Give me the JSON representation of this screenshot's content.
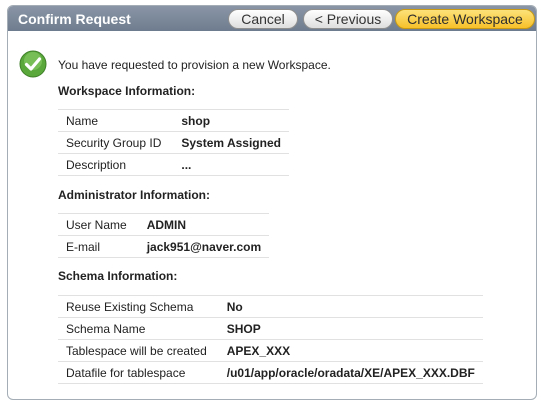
{
  "header": {
    "title": "Confirm Request",
    "buttons": {
      "cancel": "Cancel",
      "previous": "< Previous",
      "create": "Create Workspace"
    }
  },
  "intro_text": "You have requested to provision a new Workspace.",
  "icons": {
    "status": "success-check-icon"
  },
  "colors": {
    "header_bg": "#7a8799",
    "primary_button": "#f7c12a",
    "check_icon": "#4e9e34"
  },
  "workspace": {
    "title": "Workspace Information:",
    "rows": [
      {
        "label": "Name",
        "value": "shop"
      },
      {
        "label": "Security Group ID",
        "value": "System Assigned"
      },
      {
        "label": "Description",
        "value": "..."
      }
    ]
  },
  "administrator": {
    "title": "Administrator Information:",
    "rows": [
      {
        "label": "User Name",
        "value": "ADMIN"
      },
      {
        "label": "E-mail",
        "value": "jack951@naver.com"
      }
    ]
  },
  "schema": {
    "title": "Schema Information:",
    "rows": [
      {
        "label": "Reuse Existing Schema",
        "value": "No"
      },
      {
        "label": "Schema Name",
        "value": "SHOP"
      },
      {
        "label": "Tablespace will be created",
        "value": "APEX_XXX"
      },
      {
        "label": "Datafile for tablespace",
        "value": "/u01/app/oracle/oradata/XE/APEX_XXX.DBF"
      }
    ]
  }
}
